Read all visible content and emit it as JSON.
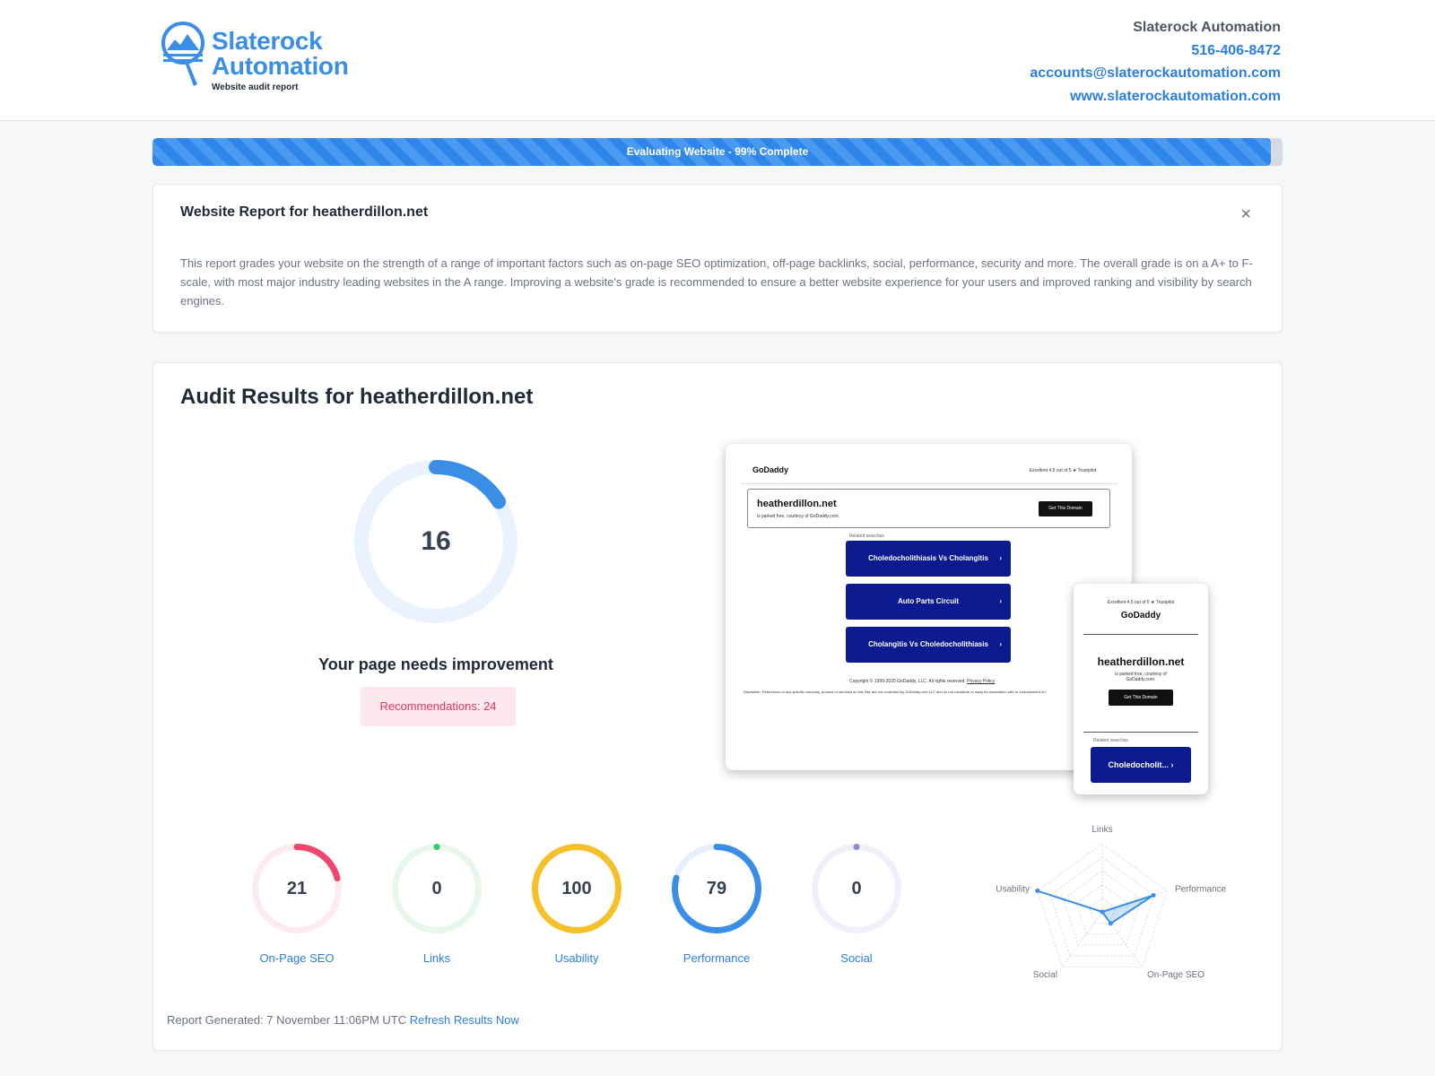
{
  "header": {
    "logo_line1": "Slaterock",
    "logo_line2": "Automation",
    "logo_sub": "Website audit report",
    "company": "Slaterock Automation",
    "phone": "516-406-8472",
    "email": "accounts@slaterockautomation.com",
    "website": "www.slaterockautomation.com"
  },
  "progress": {
    "label": "Evaluating Website - 99% Complete",
    "percent": 99
  },
  "report_card": {
    "title": "Website Report for heatherdillon.net",
    "close": "×",
    "description": "This report grades your website on the strength of a range of important factors such as on-page SEO optimization, off-page backlinks, social, performance, security and more. The overall grade is on a A+ to F-scale, with most major industry leading websites in the A range. Improving a website's grade is recommended to ensure a better website experience for your users and improved ranking and visibility by search engines."
  },
  "audit": {
    "title": "Audit Results for heatherdillon.net",
    "score": 16,
    "verdict": "Your page needs improvement",
    "recommendations": "Recommendations: 24",
    "colors": {
      "main": "#3a8ee6",
      "track": "#eaf3fd"
    }
  },
  "preview": {
    "desktop": {
      "brand": "GoDaddy",
      "rating": "Excellent   4.5 out of 5  ★ Trustpilot",
      "domain": "heatherdillon.net",
      "parked": "is parked free, courtesy of GoDaddy.com.",
      "cta": "Get This Domain",
      "related": "Related searches",
      "results": [
        "Choledocholithiasis Vs Cholangitis",
        "Auto Parts Circuit",
        "Cholangitis Vs Choledocholithiasis"
      ],
      "copyright": "Copyright © 1999-2025 GoDaddy, LLC. All rights reserved.",
      "privacy": "Privacy Policy",
      "disclaimer": "Disclaimer: References to any specific company, product or services on this Site are not controlled by GoDaddy.com LLC and do not constitute or imply its association with or endorsement of t"
    },
    "mobile": {
      "rating": "Excellent   4.5 out of 5  ★ Trustpilot",
      "brand": "GoDaddy",
      "domain": "heatherdillon.net",
      "parked": "is parked free, courtesy of GoDaddy.com.",
      "cta": "Get This Domain",
      "related": "Related searches",
      "result": "Choledocholit..."
    }
  },
  "categories": [
    {
      "label": "On-Page SEO",
      "score": 21,
      "color": "#f0466e",
      "track": "#fdebef"
    },
    {
      "label": "Links",
      "score": 0,
      "color": "#35c76a",
      "track": "#e6f8ec"
    },
    {
      "label": "Usability",
      "score": 100,
      "color": "#f5c02a",
      "track": "#fdf3d4"
    },
    {
      "label": "Performance",
      "score": 79,
      "color": "#3a8ee6",
      "track": "#e6f0fc"
    },
    {
      "label": "Social",
      "score": 0,
      "color": "#8b8bd8",
      "track": "#f0f0fb"
    }
  ],
  "radar": {
    "axes": [
      "Links",
      "Performance",
      "On-Page SEO",
      "Social",
      "Usability"
    ],
    "values": [
      0,
      79,
      21,
      0,
      100
    ]
  },
  "footer": {
    "generated": "Report Generated: 7 November 11:06PM UTC",
    "refresh": "Refresh Results Now"
  }
}
